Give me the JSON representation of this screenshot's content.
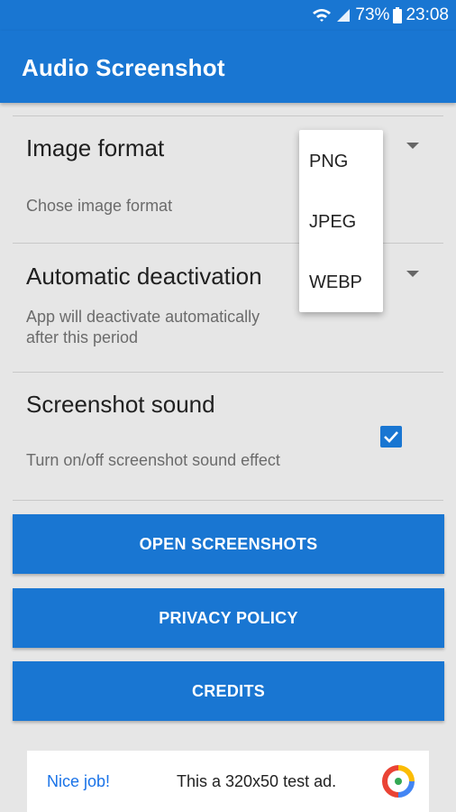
{
  "status_bar": {
    "battery": "73%",
    "time": "23:08"
  },
  "app_bar": {
    "title": "Audio Screenshot"
  },
  "settings": [
    {
      "title": "Image format",
      "subtitle": "Chose image format"
    },
    {
      "title": "Automatic deactivation",
      "subtitle_line1": "App will deactivate automatically",
      "subtitle_line2": "after this period"
    },
    {
      "title": "Screenshot sound",
      "subtitle": "Turn on/off screenshot sound effect",
      "checked": true
    }
  ],
  "buttons": {
    "open_screenshots": "OPEN SCREENSHOTS",
    "privacy_policy": "PRIVACY POLICY",
    "credits": "CREDITS"
  },
  "ad": {
    "left_text": "Nice job!",
    "text": "This a 320x50 test ad."
  },
  "format_popup": {
    "options": [
      "PNG",
      "JPEG",
      "WEBP"
    ]
  },
  "colors": {
    "primary": "#1976d2",
    "background": "#e6e6e6",
    "ad_link": "#1a73e8"
  }
}
